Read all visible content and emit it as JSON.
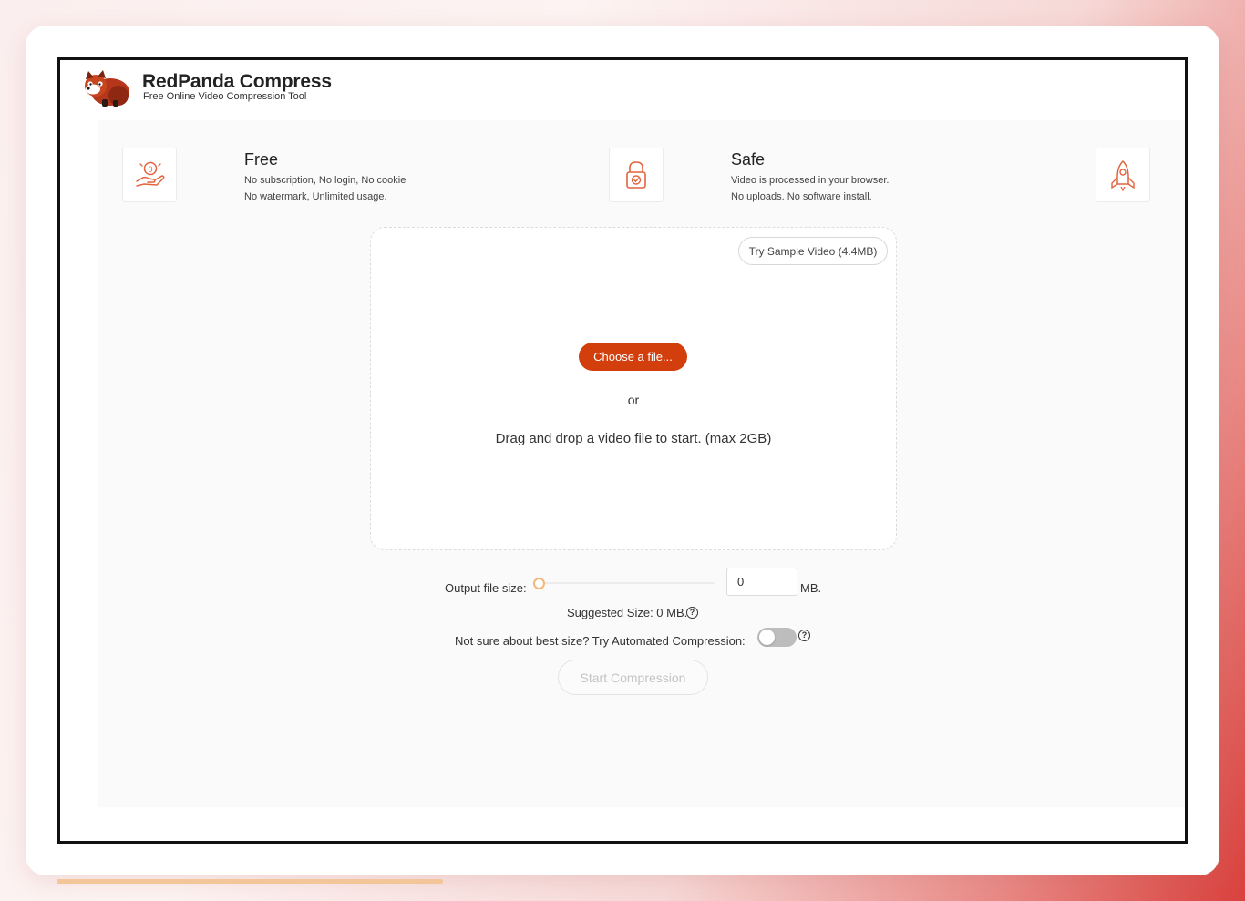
{
  "brand": {
    "title": "RedPanda Compress",
    "subtitle": "Free Online Video Compression Tool",
    "logo_icon": "red-panda-logo"
  },
  "features": [
    {
      "icon": "hand-coin-icon",
      "title": "Free",
      "line1": "No subscription, No login, No cookie",
      "line2": "No watermark, Unlimited usage."
    },
    {
      "icon": "lock-icon",
      "title": "Safe",
      "line1": "Video is processed in your browser.",
      "line2": "No uploads. No software install."
    },
    {
      "icon": "rocket-icon"
    }
  ],
  "dropzone": {
    "sample_button": "Try Sample Video (4.4MB)",
    "choose_button": "Choose a file...",
    "or_text": "or",
    "drop_text": "Drag and drop a video file to start. (max 2GB)"
  },
  "output": {
    "label": "Output file size:",
    "value": "0",
    "unit": "MB.",
    "slider_level": 0,
    "suggested": "Suggested Size: 0 MB."
  },
  "auto": {
    "label": "Not sure about best size? Try Automated Compression:",
    "enabled": false
  },
  "start_button": "Start Compression",
  "colors": {
    "accent": "#d33f0c",
    "icon_stroke": "#e2643e",
    "slider_thumb": "#f3b77b"
  }
}
